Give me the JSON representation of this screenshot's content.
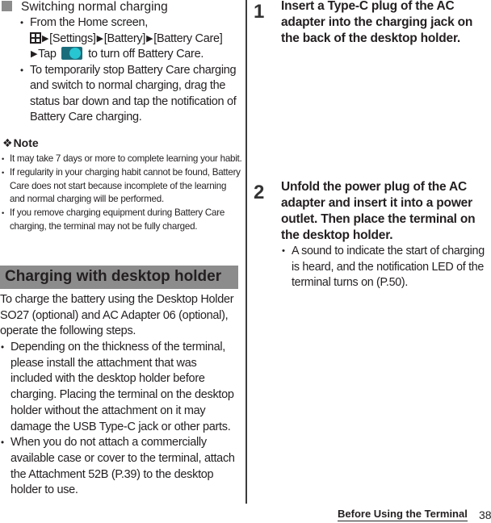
{
  "left": {
    "subheading": "Switching normal charging",
    "switch_items": [
      {
        "intro": "From the Home screen,",
        "path": [
          "[Settings]",
          "[Battery]",
          "[Battery Care]"
        ],
        "tap_prefix": "Tap",
        "tap_suffix": "to turn off Battery Care.",
        "icons": [
          "apps-grid-icon",
          "toggle-on-icon"
        ]
      },
      {
        "text": "To temporarily stop Battery Care charging and switch to normal charging, drag the status bar down and tap the notification of Battery Care charging."
      }
    ],
    "note": {
      "symbol": "❖",
      "title": "Note",
      "items": [
        "It may take 7 days or more to complete learning your habit.",
        "If regularity in your charging habit cannot be found, Battery Care does not start because incomplete of the learning and normal charging will be performed.",
        "If you remove charging equipment during Battery Care charging, the terminal may not be fully charged."
      ]
    },
    "section_title": "Charging with desktop holder",
    "intro": "To charge the battery using the Desktop Holder SO27 (optional) and AC Adapter 06 (optional), operate the following steps.",
    "bullets": [
      "Depending on the thickness of the terminal, please install the attachment that was included with the desktop holder before charging. Placing the terminal on the desktop holder without the attachment on it may damage the USB Type-C jack or other parts.",
      "When you do not attach a commercially available case or cover to the terminal, attach the Attachment 52B (P.39) to the desktop holder to use."
    ]
  },
  "right": {
    "steps": [
      {
        "number": "1",
        "text": "Insert a Type-C plug of the AC adapter into the charging jack on the back of the desktop holder.",
        "bullets": []
      },
      {
        "number": "2",
        "text": "Unfold the power plug of the AC adapter and insert it into a power outlet. Then place the terminal on the desktop holder.",
        "bullets": [
          "A sound to indicate the start of charging is heard, and the notification LED of the terminal turns on (P.50)."
        ]
      }
    ]
  },
  "footer": {
    "chapter": "Before Using the Terminal",
    "page": "38"
  },
  "colors": {
    "band": "#8c8c8c",
    "toggle_track": "#1c6d7c",
    "toggle_knob": "#28c5d2"
  }
}
